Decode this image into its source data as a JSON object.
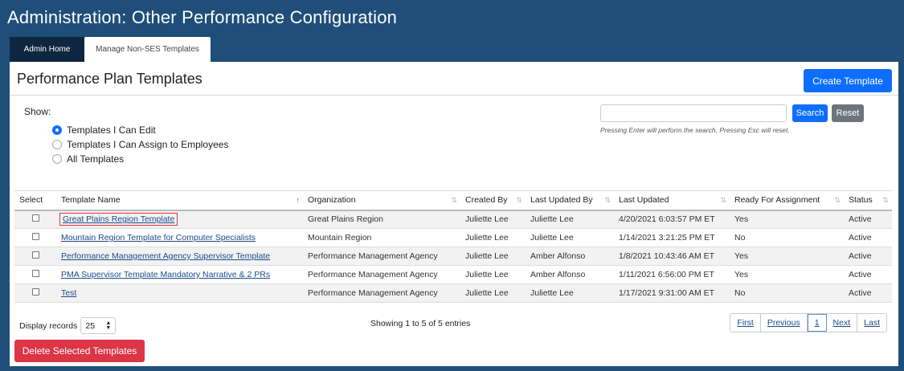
{
  "page": {
    "title": "Administration: Other Performance Configuration"
  },
  "tabs": [
    {
      "label": "Admin Home"
    },
    {
      "label": "Manage Non-SES Templates"
    }
  ],
  "panel": {
    "title": "Performance Plan Templates",
    "create_label": "Create Template"
  },
  "filter": {
    "show_label": "Show:",
    "options": [
      {
        "label": "Templates I Can Edit",
        "checked": true
      },
      {
        "label": "Templates I Can Assign to Employees",
        "checked": false
      },
      {
        "label": "All Templates",
        "checked": false
      }
    ]
  },
  "search": {
    "value": "",
    "placeholder": "",
    "search_label": "Search",
    "reset_label": "Reset",
    "hint": "Pressing Enter will perform the search. Pressing Esc will reset."
  },
  "table": {
    "columns": [
      "Select",
      "Template Name",
      "Organization",
      "Created By",
      "Last Updated By",
      "Last Updated",
      "Ready For Assignment",
      "Status"
    ],
    "rows": [
      [
        "Great Plains Region Template",
        "Great Plains Region",
        "Juliette Lee",
        "Juliette Lee",
        "4/20/2021 6:03:57 PM ET",
        "Yes",
        "Active"
      ],
      [
        "Mountain Region Template for Computer Specialists",
        "Mountain Region",
        "Juliette Lee",
        "Juliette Lee",
        "1/14/2021 3:21:25 PM ET",
        "No",
        "Active"
      ],
      [
        "Performance Management Agency Supervisor Template",
        "Performance Management Agency",
        "Juliette Lee",
        "Amber Alfonso",
        "1/8/2021 10:43:46 AM ET",
        "Yes",
        "Active"
      ],
      [
        "PMA Supervisor Template Mandatory Narrative & 2 PRs",
        "Performance Management Agency",
        "Juliette Lee",
        "Amber Alfonso",
        "1/11/2021 6:56:00 PM ET",
        "Yes",
        "Active"
      ],
      [
        "Test",
        "Performance Management Agency",
        "Juliette Lee",
        "Juliette Lee",
        "1/17/2021 9:31:00 AM ET",
        "No",
        "Active"
      ]
    ]
  },
  "footer": {
    "records_label": "Display records",
    "records_value": "25",
    "showing": "Showing 1 to 5 of 5 entries",
    "pager": {
      "first": "First",
      "previous": "Previous",
      "current": "1",
      "next": "Next",
      "last": "Last"
    },
    "delete_label": "Delete Selected Templates"
  },
  "colors": {
    "background": "#1f4e79",
    "primary": "#0d6efd",
    "danger": "#dc3545",
    "tab_dark": "#0f2640"
  }
}
